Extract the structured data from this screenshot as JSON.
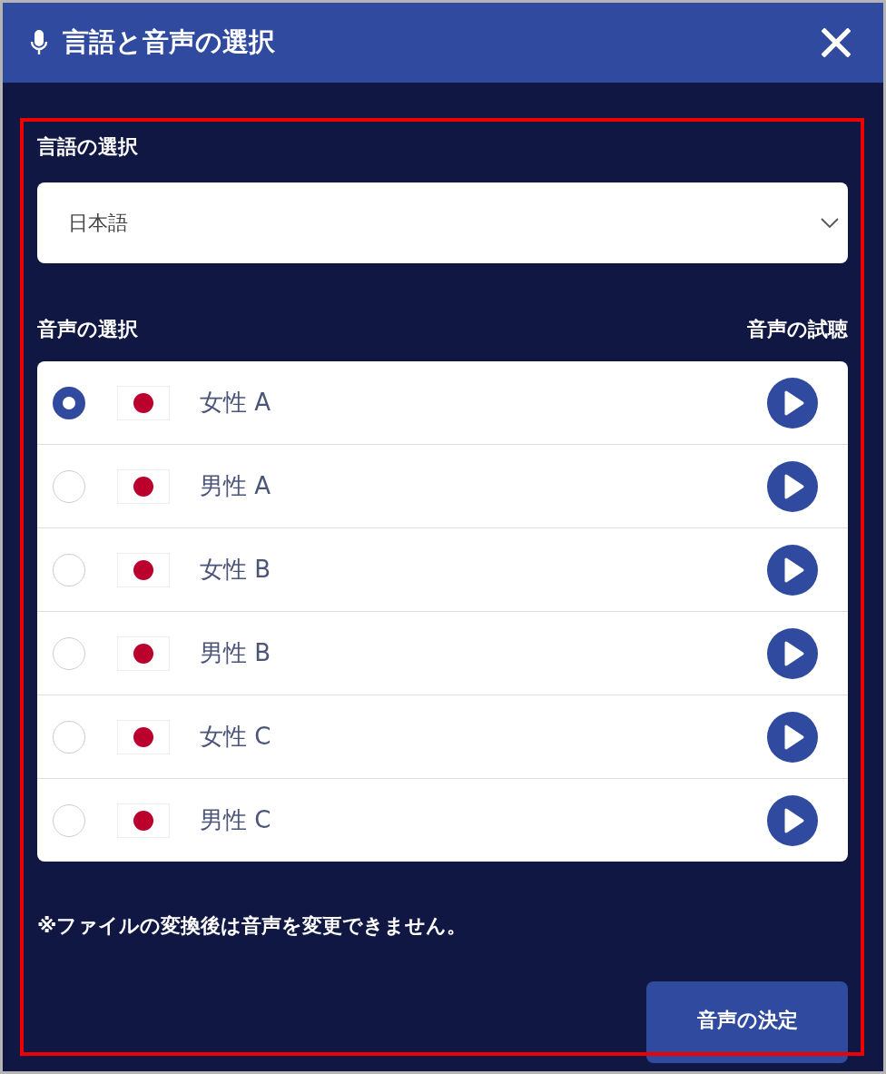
{
  "header": {
    "title": "言語と音声の選択"
  },
  "language": {
    "label": "言語の選択",
    "value": "日本語"
  },
  "voice": {
    "label": "音声の選択",
    "preview_label": "音声の試聴",
    "options": [
      {
        "name": "女性 A",
        "selected": true
      },
      {
        "name": "男性 A",
        "selected": false
      },
      {
        "name": "女性 B",
        "selected": false
      },
      {
        "name": "男性 B",
        "selected": false
      },
      {
        "name": "女性 C",
        "selected": false
      },
      {
        "name": "男性 C",
        "selected": false
      }
    ]
  },
  "note": "※ファイルの変換後は音声を変更できません。",
  "confirm_button": "音声の決定"
}
